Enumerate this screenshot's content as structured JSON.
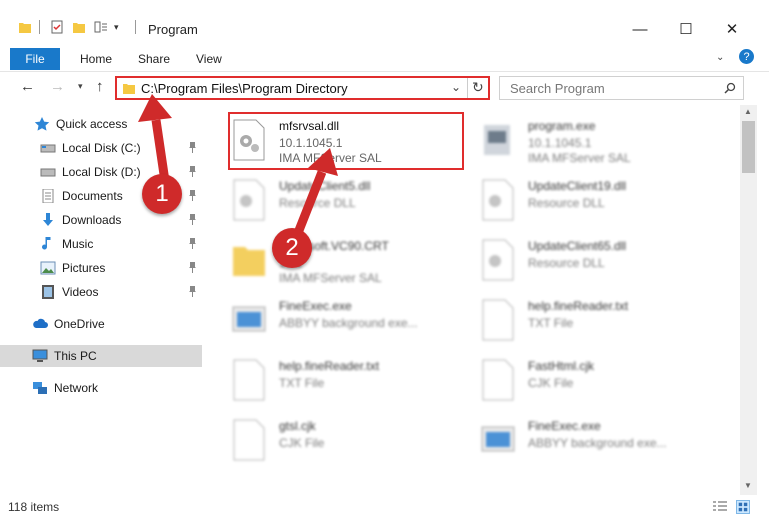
{
  "window": {
    "title": "Program"
  },
  "ribbon": {
    "file": "File",
    "tabs": [
      "Home",
      "Share",
      "View"
    ]
  },
  "window_controls": {
    "minimize": "—",
    "maximize": "☐",
    "close": "✕"
  },
  "address": {
    "path": "C:\\Program Files\\Program Directory"
  },
  "search": {
    "placeholder": "Search Program"
  },
  "sidebar": {
    "items": [
      {
        "label": "Quick access"
      },
      {
        "label": "Local Disk (C:)"
      },
      {
        "label": "Local Disk (D:)"
      },
      {
        "label": "Documents"
      },
      {
        "label": "Downloads"
      },
      {
        "label": "Music"
      },
      {
        "label": "Pictures"
      },
      {
        "label": "Videos"
      },
      {
        "label": "OneDrive"
      },
      {
        "label": "This PC"
      },
      {
        "label": "Network"
      }
    ]
  },
  "files": [
    {
      "name": "mfsrvsal.dll",
      "line2": "10.1.1045.1",
      "line3": "IMA MFServer SAL"
    },
    {
      "name": "program.exe",
      "line2": "10.1.1045.1",
      "line3": "IMA MFServer SAL"
    },
    {
      "name": "UpdateClient5.dll",
      "line2": "Resource DLL",
      "line3": ""
    },
    {
      "name": "UpdateClient19.dll",
      "line2": "Resource DLL",
      "line3": ""
    },
    {
      "name": "Microsoft.VC90.CRT",
      "line2": "10.1",
      "line3": "IMA MFServer SAL"
    },
    {
      "name": "UpdateClient65.dll",
      "line2": "Resource DLL",
      "line3": ""
    },
    {
      "name": "FineExec.exe",
      "line2": "ABBYY background exe...",
      "line3": ""
    },
    {
      "name": "help.fineReader.txt",
      "line2": "TXT File",
      "line3": ""
    },
    {
      "name": "help.fineReader.txt",
      "line2": "TXT File",
      "line3": ""
    },
    {
      "name": "FastHtml.cjk",
      "line2": "CJK File",
      "line3": ""
    },
    {
      "name": "gtsl.cjk",
      "line2": "CJK File",
      "line3": ""
    },
    {
      "name": "FineExec.exe",
      "line2": "ABBYY background exe...",
      "line3": ""
    }
  ],
  "status": {
    "count": "118 items"
  },
  "callouts": {
    "one": "1",
    "two": "2"
  },
  "colors": {
    "accent": "#1979ca",
    "highlight": "#e02d2d",
    "selected": "#cce8ff",
    "thispc": "#d9d9d9"
  }
}
